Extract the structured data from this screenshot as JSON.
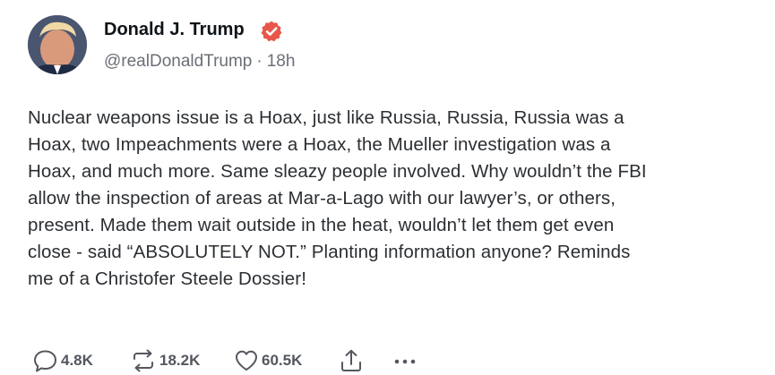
{
  "author": {
    "display_name": "Donald J. Trump",
    "handle": "@realDonaldTrump",
    "separator": "·",
    "time_ago": "18h",
    "verified_badge": "check-badge-icon",
    "badge_color": "#e8574a"
  },
  "post": {
    "lines": [
      "Nuclear weapons issue is a Hoax, just like Russia, Russia, Russia was a",
      "Hoax, two Impeachments were a Hoax, the Mueller investigation was a",
      "Hoax, and much more. Same sleazy people involved. Why wouldn’t the FBI",
      "allow the inspection of areas at Mar-a-Lago with our lawyer’s, or others,",
      "present. Made them wait outside in the heat, wouldn’t let them get even",
      "close - said “ABSOLUTELY NOT.” Planting information anyone? Reminds",
      "me of a Christofer Steele Dossier!"
    ]
  },
  "actions": {
    "reply": {
      "icon": "reply-bubble-icon",
      "count": "4.8K"
    },
    "repost": {
      "icon": "repost-arrows-icon",
      "count": "18.2K"
    },
    "like": {
      "icon": "heart-icon",
      "count": "60.5K"
    },
    "share": {
      "icon": "share-upload-icon"
    },
    "more": {
      "icon": "more-dots-icon"
    }
  },
  "colors": {
    "text": "#2b2f33",
    "name": "#0f1419",
    "muted": "#6b6f76",
    "icon": "#53575e"
  }
}
